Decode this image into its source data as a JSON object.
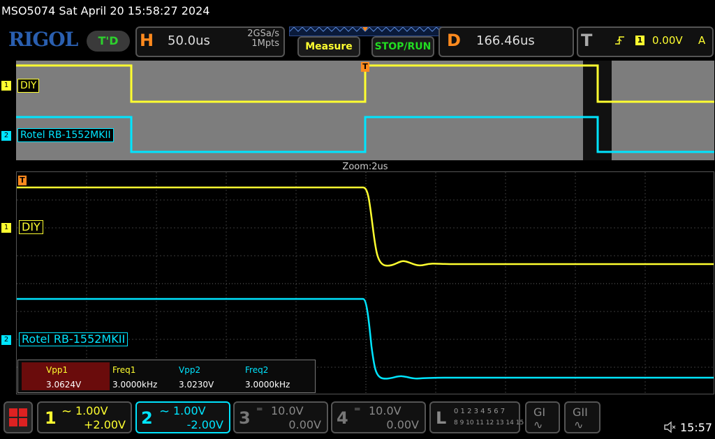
{
  "title_bar": {
    "text": "MSO5074  Sat April 20 15:58:27 2024"
  },
  "brand": {
    "logo": "RIGOL",
    "mode_badge": "T'D"
  },
  "horizontal": {
    "letter": "H",
    "timebase": "50.0us",
    "sample_rate": "2GSa/s",
    "memory_depth": "1Mpts"
  },
  "buttons": {
    "measure": "Measure",
    "stop_run": "STOP/RUN"
  },
  "delay": {
    "letter": "D",
    "value": "166.46us"
  },
  "trigger": {
    "letter": "T",
    "source": "1",
    "level": "0.00V",
    "mode": "A",
    "edge_icon": "rising-edge-icon"
  },
  "overview": {
    "ch1_label": "DIY",
    "ch1_num": "1",
    "ch2_label": "Rotel RB-1552MKII",
    "ch2_num": "2",
    "trigger_marker": "T"
  },
  "zoom": {
    "label": "Zoom:2us",
    "trigger_marker": "T"
  },
  "main": {
    "ch1_label": "DIY",
    "ch1_num": "1",
    "ch2_label": "Rotel RB-1552MKII",
    "ch2_num": "2"
  },
  "measurements": [
    {
      "name": "Vpp1",
      "value": "3.0624V"
    },
    {
      "name": "Freq1",
      "value": "3.0000kHz"
    },
    {
      "name": "Vpp2",
      "value": "3.0230V"
    },
    {
      "name": "Freq2",
      "value": "3.0000kHz"
    }
  ],
  "channels": [
    {
      "num": "1",
      "scale": "1.00V",
      "offset": "+2.00V",
      "coupling_icon": "ac-coupling-icon",
      "color": "#ffff30"
    },
    {
      "num": "2",
      "scale": "1.00V",
      "offset": "-2.00V",
      "coupling_icon": "ac-coupling-icon",
      "color": "#00e5ff"
    },
    {
      "num": "3",
      "scale": "10.0V",
      "offset": "0.00V",
      "coupling_icon": "dc-coupling-icon",
      "color": "#888888"
    },
    {
      "num": "4",
      "scale": "10.0V",
      "offset": "0.00V",
      "coupling_icon": "dc-coupling-icon",
      "color": "#888888"
    }
  ],
  "logic": {
    "letter": "L",
    "row1": "0 1 2 3  4 5 6 7",
    "row2": "8 9 10 11 12 13 14 15"
  },
  "generators": [
    {
      "label": "GI"
    },
    {
      "label": "GII"
    }
  ],
  "status": {
    "clock": "15:57",
    "speaker_icon": "speaker-mute-icon"
  },
  "colors": {
    "ch1": "#ffff30",
    "ch2": "#00e5ff",
    "accent": "#ff8a1e"
  }
}
